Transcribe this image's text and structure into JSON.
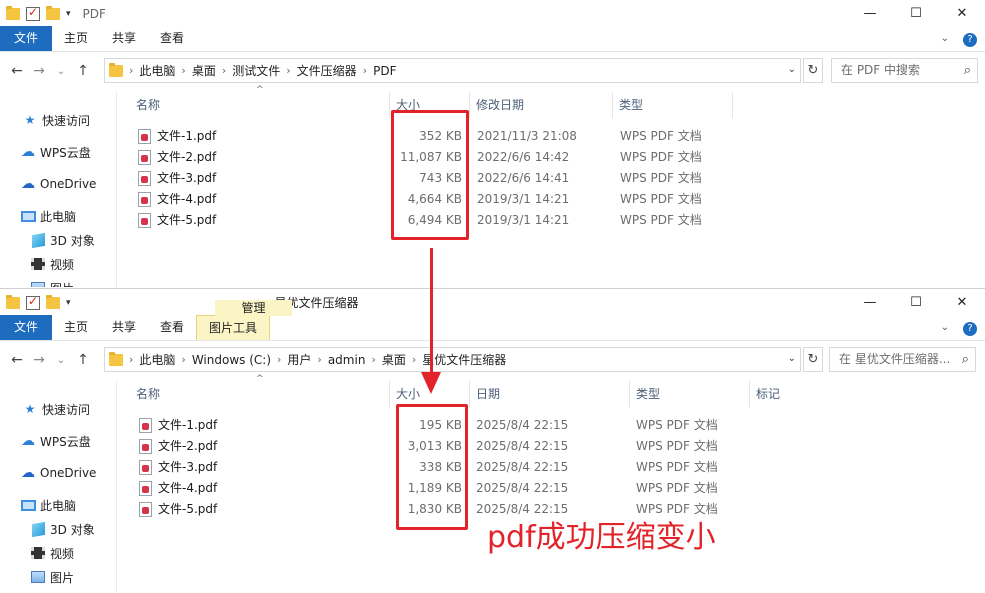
{
  "window1": {
    "title": "PDF",
    "ribbon_tabs": [
      "文件",
      "主页",
      "共享",
      "查看"
    ],
    "breadcrumbs": [
      "此电脑",
      "桌面",
      "测试文件",
      "文件压缩器",
      "PDF"
    ],
    "search_placeholder": "在 PDF 中搜索",
    "nav": [
      "快速访问",
      "WPS云盘",
      "OneDrive",
      "此电脑",
      "3D 对象",
      "视频",
      "图片"
    ],
    "columns": {
      "name": "名称",
      "size": "大小",
      "date": "修改日期",
      "type": "类型"
    },
    "files": [
      {
        "name": "文件-1.pdf",
        "size": "352 KB",
        "date": "2021/11/3 21:08",
        "type": "WPS PDF 文档"
      },
      {
        "name": "文件-2.pdf",
        "size": "11,087 KB",
        "date": "2022/6/6 14:42",
        "type": "WPS PDF 文档"
      },
      {
        "name": "文件-3.pdf",
        "size": "743 KB",
        "date": "2022/6/6 14:41",
        "type": "WPS PDF 文档"
      },
      {
        "name": "文件-4.pdf",
        "size": "4,664 KB",
        "date": "2019/3/1 14:21",
        "type": "WPS PDF 文档"
      },
      {
        "name": "文件-5.pdf",
        "size": "6,494 KB",
        "date": "2019/3/1 14:21",
        "type": "WPS PDF 文档"
      }
    ]
  },
  "window2": {
    "title": "星优文件压缩器",
    "context_tab_group": "管理",
    "ribbon_tabs": [
      "文件",
      "主页",
      "共享",
      "查看"
    ],
    "context_tab": "图片工具",
    "breadcrumbs": [
      "此电脑",
      "Windows (C:)",
      "用户",
      "admin",
      "桌面",
      "星优文件压缩器"
    ],
    "search_placeholder": "在 星优文件压缩器...",
    "nav": [
      "快速访问",
      "WPS云盘",
      "OneDrive",
      "此电脑",
      "3D 对象",
      "视频",
      "图片"
    ],
    "columns": {
      "name": "名称",
      "size": "大小",
      "date": "日期",
      "type": "类型",
      "tags": "标记"
    },
    "files": [
      {
        "name": "文件-1.pdf",
        "size": "195 KB",
        "date": "2025/8/4 22:15",
        "type": "WPS PDF 文档"
      },
      {
        "name": "文件-2.pdf",
        "size": "3,013 KB",
        "date": "2025/8/4 22:15",
        "type": "WPS PDF 文档"
      },
      {
        "name": "文件-3.pdf",
        "size": "338 KB",
        "date": "2025/8/4 22:15",
        "type": "WPS PDF 文档"
      },
      {
        "name": "文件-4.pdf",
        "size": "1,189 KB",
        "date": "2025/8/4 22:15",
        "type": "WPS PDF 文档"
      },
      {
        "name": "文件-5.pdf",
        "size": "1,830 KB",
        "date": "2025/8/4 22:15",
        "type": "WPS PDF 文档"
      }
    ]
  },
  "annotation": {
    "caption": "pdf成功压缩变小",
    "color": "#e2242a"
  },
  "icons": [
    "folder-icon",
    "checkmark-icon",
    "back-arrow-icon",
    "forward-arrow-icon",
    "up-arrow-icon",
    "refresh-icon",
    "search-icon",
    "star-icon",
    "cloud-icon",
    "pc-icon",
    "cube-icon",
    "film-icon",
    "picture-icon",
    "pdf-file-icon"
  ]
}
